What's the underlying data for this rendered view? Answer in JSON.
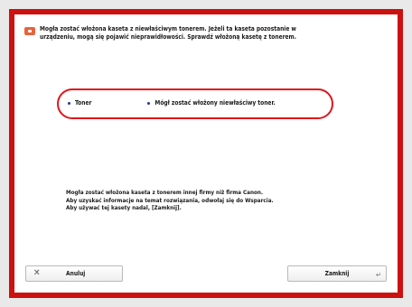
{
  "dialog": {
    "message_line1": "Mogła zostać włożona kaseta z niewłaściwym tonerem. Jeżeli ta kaseta pozostanie w",
    "message_line2": "urządzeniu, mogą się pojawić nieprawidłowości. Sprawdź włożoną kasetę z tonerem.",
    "toner_label": "Toner",
    "toner_status": "Mógł zostać włożony niewłaściwy toner.",
    "info_lines": [
      "Mogła zostać włożona kaseta z tonerem innej firmy niż firma Canon.",
      "Aby uzyskać informacje na temat rozwiązania, odwołaj się do Wsparcia.",
      "Aby używać tej kasety nadal, [Zamknij]."
    ],
    "cancel_label": "Anuluj",
    "close_label": "Zamknij"
  },
  "colors": {
    "frame": "#cc1111",
    "highlight": "#e0141a",
    "warning_icon": "#e8633a",
    "bullet": "#1f3a8c"
  },
  "icons": {
    "warning": "warning-icon",
    "cancel": "close-x-icon",
    "enter": "enter-icon"
  }
}
